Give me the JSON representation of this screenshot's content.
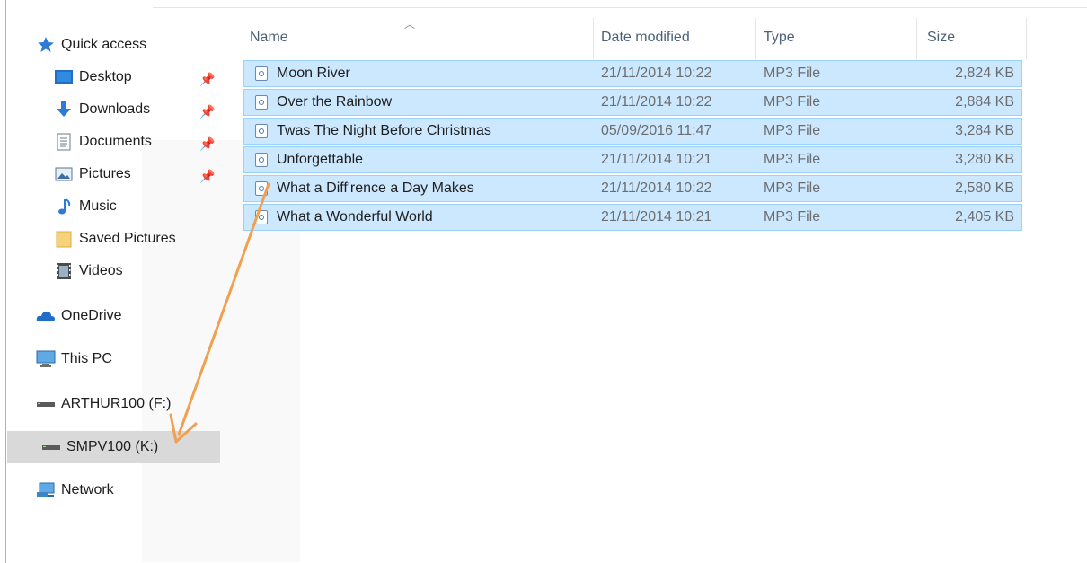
{
  "nav": {
    "quick_access": "Quick access",
    "items": [
      {
        "label": "Desktop",
        "icon": "desktop-icon",
        "pinned": true
      },
      {
        "label": "Downloads",
        "icon": "downloads-icon",
        "pinned": true
      },
      {
        "label": "Documents",
        "icon": "documents-icon",
        "pinned": true
      },
      {
        "label": "Pictures",
        "icon": "pictures-icon",
        "pinned": true
      },
      {
        "label": "Music",
        "icon": "music-icon",
        "pinned": false
      },
      {
        "label": "Saved Pictures",
        "icon": "folder-icon",
        "pinned": false
      },
      {
        "label": "Videos",
        "icon": "videos-icon",
        "pinned": false
      }
    ],
    "onedrive": "OneDrive",
    "this_pc": "This PC",
    "drive_f": "ARTHUR100 (F:)",
    "drive_k": "SMPV100 (K:)",
    "network": "Network"
  },
  "file_list": {
    "columns": {
      "name": "Name",
      "date": "Date modified",
      "type": "Type",
      "size": "Size"
    },
    "rows": [
      {
        "name": "Moon River",
        "date": "21/11/2014 10:22",
        "type": "MP3 File",
        "size": "2,824 KB"
      },
      {
        "name": "Over the Rainbow",
        "date": "21/11/2014 10:22",
        "type": "MP3 File",
        "size": "2,884 KB"
      },
      {
        "name": "Twas The Night Before Christmas",
        "date": "05/09/2016 11:47",
        "type": "MP3 File",
        "size": "3,284 KB"
      },
      {
        "name": "Unforgettable",
        "date": "21/11/2014 10:21",
        "type": "MP3 File",
        "size": "3,280 KB"
      },
      {
        "name": "What a Diff'rence a Day Makes",
        "date": "21/11/2014 10:22",
        "type": "MP3 File",
        "size": "2,580 KB"
      },
      {
        "name": "What a Wonderful World",
        "date": "21/11/2014 10:21",
        "type": "MP3 File",
        "size": "2,405 KB"
      }
    ]
  },
  "colors": {
    "selection": "#cce8ff",
    "selection_border": "#99d1ff",
    "arrow": "#f0a050",
    "hover": "#d9d9d9"
  }
}
